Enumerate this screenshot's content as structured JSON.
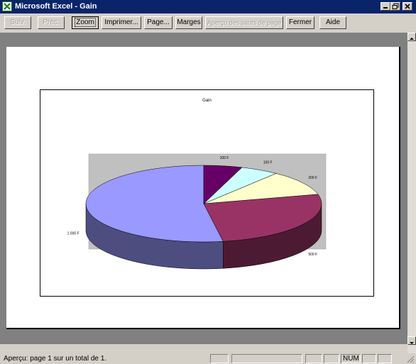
{
  "window": {
    "title": "Microsoft Excel - Gain"
  },
  "toolbar": {
    "buttons": [
      {
        "label": "Suiv.",
        "enabled": false
      },
      {
        "label": "Préc.",
        "enabled": false
      },
      {
        "label": "Zoom",
        "enabled": true,
        "focused": true
      },
      {
        "label": "Imprimer...",
        "enabled": true
      },
      {
        "label": "Page...",
        "enabled": true
      },
      {
        "label": "Marges",
        "enabled": true
      },
      {
        "label": "Aperçu des sauts de page",
        "enabled": false
      },
      {
        "label": "Fermer",
        "enabled": true
      },
      {
        "label": "Aide",
        "enabled": true
      }
    ]
  },
  "chart_data": {
    "type": "pie",
    "title": "Gain",
    "categories": [
      "1 000 F",
      "500 F",
      "200 F",
      "100 F",
      "100 F"
    ],
    "values": [
      1000,
      500,
      200,
      100,
      100
    ],
    "data_labels": [
      "1 000 F",
      "500 F",
      "200 F",
      "100 F",
      "100 F"
    ],
    "colors": [
      "#9999ff",
      "#993366",
      "#ffffcc",
      "#ccffff",
      "#660066"
    ],
    "three_d": true,
    "legend": "none"
  },
  "statusbar": {
    "message": "Aperçu: page 1 sur un total de 1.",
    "num_indicator": "NUM"
  },
  "colors": {
    "titlebar": "#0a246a",
    "workspace": "#808080",
    "chrome": "#d4d0c8"
  }
}
